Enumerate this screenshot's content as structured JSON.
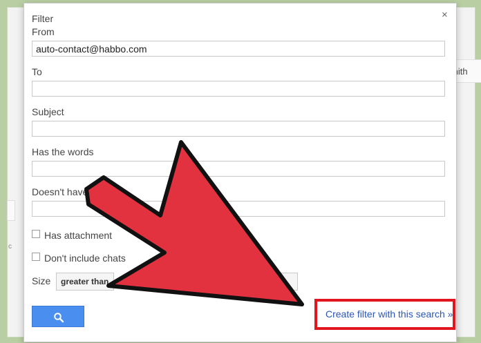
{
  "background": {
    "peek_right_text": "mith",
    "left_dot": "c"
  },
  "dialog": {
    "title": "Filter",
    "close": "×",
    "from": {
      "label": "From",
      "value": "auto-contact@habbo.com"
    },
    "to": {
      "label": "To",
      "value": ""
    },
    "subject": {
      "label": "Subject",
      "value": ""
    },
    "has_words": {
      "label": "Has the words",
      "value": ""
    },
    "doesnt_have": {
      "label": "Doesn't have",
      "value": ""
    },
    "has_attachment": {
      "label": "Has attachment",
      "checked": false
    },
    "dont_include_chats": {
      "label": "Don't include chats",
      "checked": false
    },
    "size": {
      "label": "Size",
      "selected": "greater than"
    },
    "create_filter_link": "Create filter with this search »"
  },
  "colors": {
    "accent_red": "#e3161f",
    "arrow_red": "#e3323f",
    "search_blue": "#4a8ef0",
    "link_blue": "#2a55b8"
  }
}
